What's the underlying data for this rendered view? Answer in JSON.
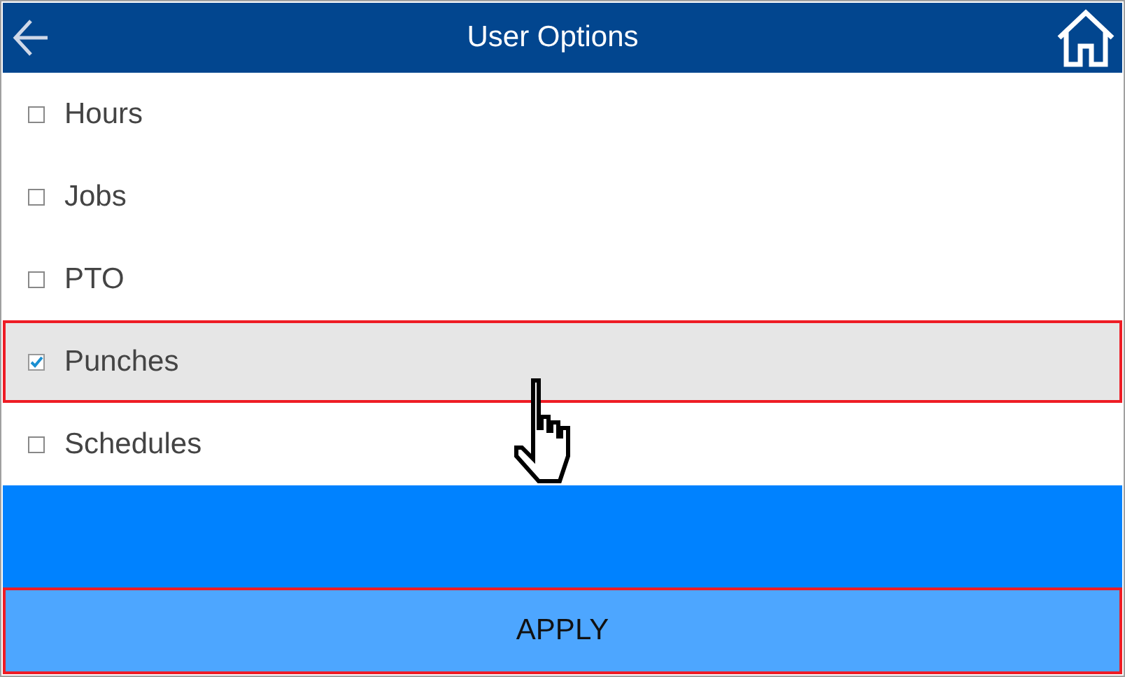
{
  "header": {
    "title": "User Options"
  },
  "options": [
    {
      "label": "Hours",
      "checked": false,
      "selected": false,
      "highlighted": false
    },
    {
      "label": "Jobs",
      "checked": false,
      "selected": false,
      "highlighted": false
    },
    {
      "label": "PTO",
      "checked": false,
      "selected": false,
      "highlighted": false
    },
    {
      "label": "Punches",
      "checked": true,
      "selected": true,
      "highlighted": true
    },
    {
      "label": "Schedules",
      "checked": false,
      "selected": false,
      "highlighted": false
    }
  ],
  "apply_button": {
    "label": "APPLY",
    "highlighted": true
  }
}
